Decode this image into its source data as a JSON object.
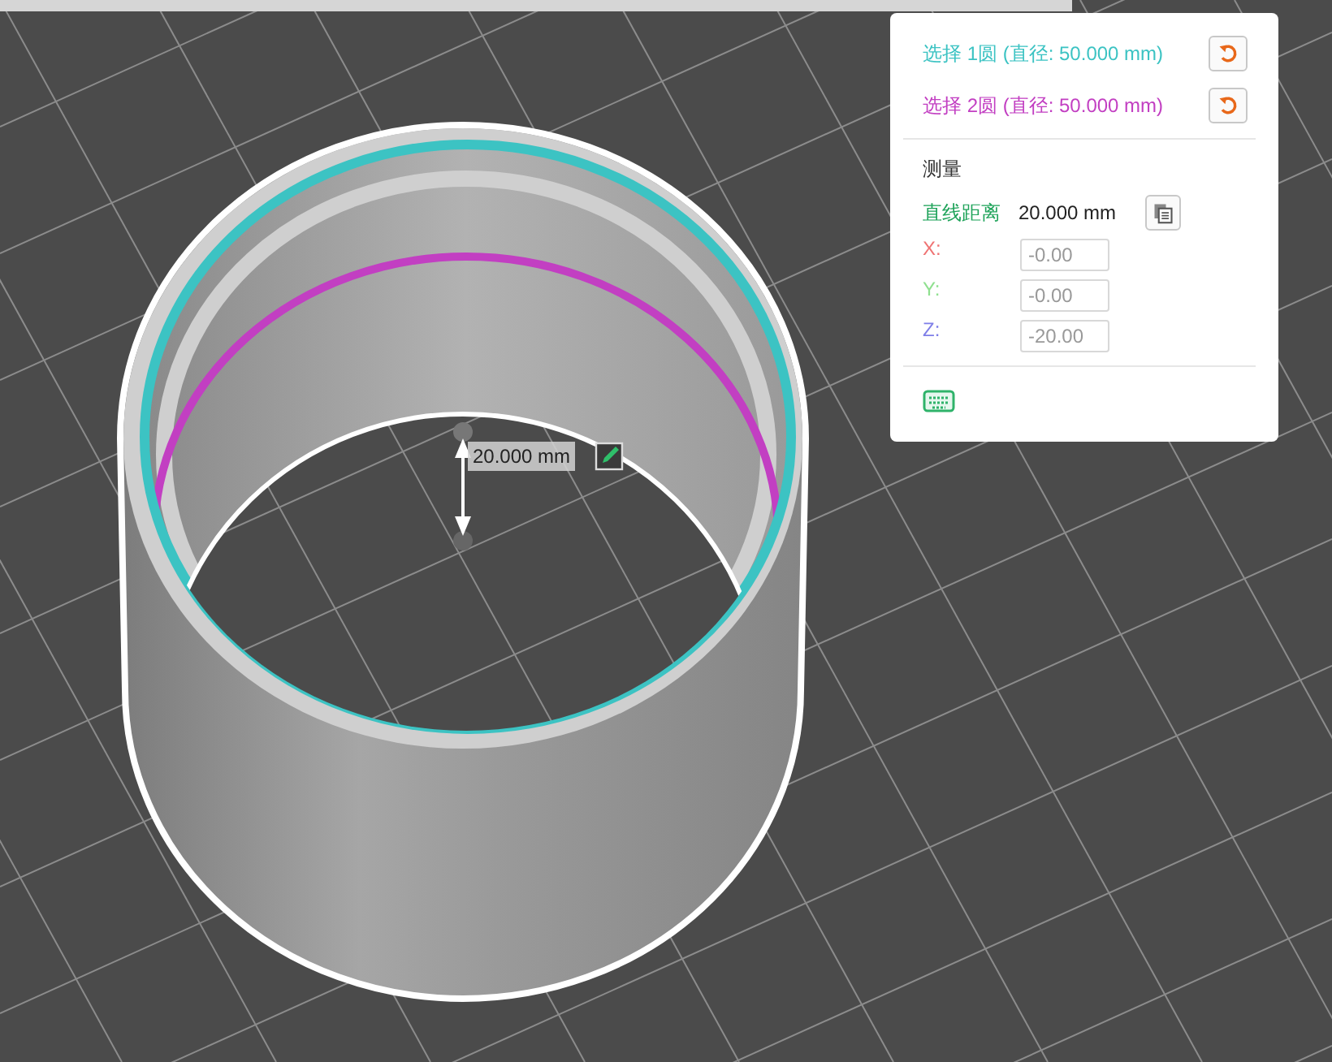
{
  "viewport": {
    "dimension_label": "20.000 mm"
  },
  "selections": [
    {
      "label": "选择 1圆 (直径: 50.000 mm)",
      "color": "#3cc3c3"
    },
    {
      "label": "选择 2圆 (直径: 50.000 mm)",
      "color": "#c23fc2"
    }
  ],
  "measure": {
    "title": "测量",
    "distance_label": "直线距离",
    "distance_value": "20.000 mm",
    "axes": [
      {
        "label": "X:",
        "value": "-0.00",
        "color": "#ef7373"
      },
      {
        "label": "Y:",
        "value": "-0.00",
        "color": "#8fe08f"
      },
      {
        "label": "Z:",
        "value": "-20.00",
        "color": "#7f7fe8"
      }
    ]
  }
}
